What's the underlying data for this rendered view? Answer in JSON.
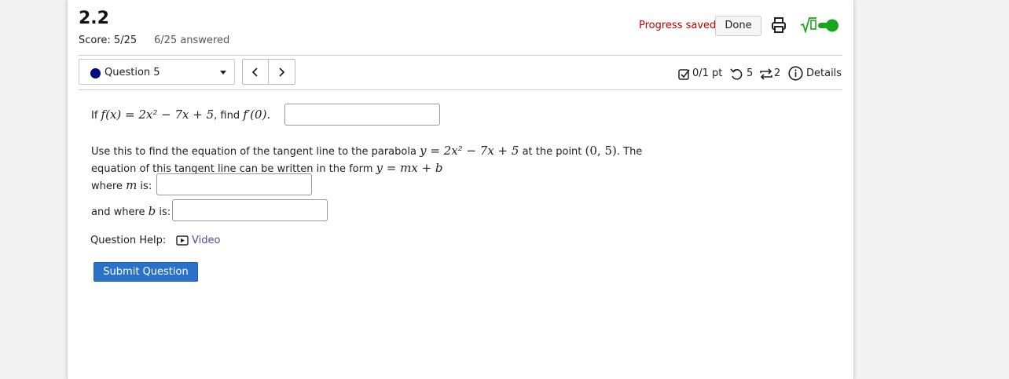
{
  "header": {
    "title": "2.2",
    "score": "Score: 5/25",
    "answered": "6/25 answered",
    "progress_saved": "Progress saved",
    "done_label": "Done",
    "toggle_label": "√0"
  },
  "question_nav": {
    "selected": "Question 5",
    "prev_symbol": "‹",
    "next_symbol": "›"
  },
  "meta": {
    "points": "0/1 pt",
    "retries": "5",
    "attempts": "2",
    "details": "Details"
  },
  "question": {
    "line1_prefix": "If ",
    "line1_mid": ", find ",
    "line1_expr": "f(x) = 2x² − 7x + 5",
    "line1_target": "f′(0).",
    "para_text1": "Use this to find the equation of the tangent line to the parabola ",
    "para_expr": "y = 2x² − 7x + 5",
    "para_text2": " at the point ",
    "para_point": "(0, 5)",
    "para_text3": ". The equation of this tangent line can be written in the form ",
    "para_form": "y = mx + b",
    "m_prefix": "where ",
    "m_var": "m",
    "m_suffix": " is:",
    "b_prefix": "and where ",
    "b_var": "b",
    "b_suffix": " is:"
  },
  "help": {
    "label": "Question Help:",
    "video": "Video"
  },
  "submit_label": "Submit Question",
  "colors": {
    "accent_blue": "#2a72c9",
    "progress_red": "#c00000",
    "toggle_green": "#1aa51a"
  }
}
